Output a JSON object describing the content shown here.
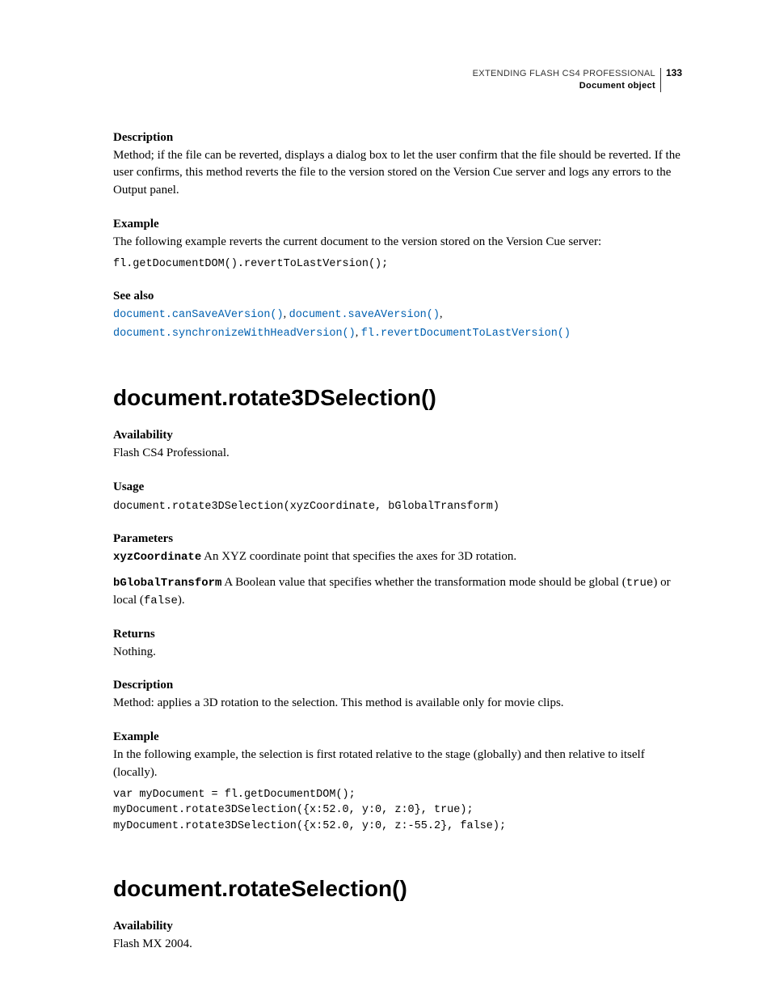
{
  "header": {
    "book_title": "EXTENDING FLASH CS4 PROFESSIONAL",
    "chapter_title": "Document object",
    "page_number": "133"
  },
  "sec1": {
    "h_description": "Description",
    "description_body": "Method; if the file can be reverted, displays a dialog box to let the user confirm that the file should be reverted. If the user confirms, this method reverts the file to the version stored on the Version Cue server and logs any errors to the Output panel.",
    "h_example": "Example",
    "example_intro": "The following example reverts the current document to the version stored on the Version Cue server:",
    "example_code": "fl.getDocumentDOM().revertToLastVersion();",
    "h_seealso": "See also",
    "see_links": {
      "l1": "document.canSaveAVersion()",
      "l2": "document.saveAVersion()",
      "l3": "document.synchronizeWithHeadVersion()",
      "l4": "fl.revertDocumentToLastVersion()"
    }
  },
  "sec2": {
    "title": "document.rotate3DSelection()",
    "h_availability": "Availability",
    "availability_body": "Flash CS4 Professional.",
    "h_usage": "Usage",
    "usage_code": "document.rotate3DSelection(xyzCoordinate, bGlobalTransform)",
    "h_parameters": "Parameters",
    "param1_name": "xyzCoordinate",
    "param1_body": "  An XYZ coordinate point that specifies the axes for 3D rotation.",
    "param2_name": "bGlobalTransform",
    "param2_body_a": "  A Boolean value that specifies whether the transformation mode should be global (",
    "param2_true": "true",
    "param2_body_b": ") or local (",
    "param2_false": "false",
    "param2_body_c": ").",
    "h_returns": "Returns",
    "returns_body": "Nothing.",
    "h_description": "Description",
    "description_body": "Method: applies a 3D rotation to the selection. This method is available only for movie clips.",
    "h_example": "Example",
    "example_intro": "In the following example, the selection is first rotated relative to the stage (globally) and then relative to itself (locally).",
    "example_code": "var myDocument = fl.getDocumentDOM();\nmyDocument.rotate3DSelection({x:52.0, y:0, z:0}, true);\nmyDocument.rotate3DSelection({x:52.0, y:0, z:-55.2}, false);"
  },
  "sec3": {
    "title": "document.rotateSelection()",
    "h_availability": "Availability",
    "availability_body": "Flash MX 2004."
  }
}
